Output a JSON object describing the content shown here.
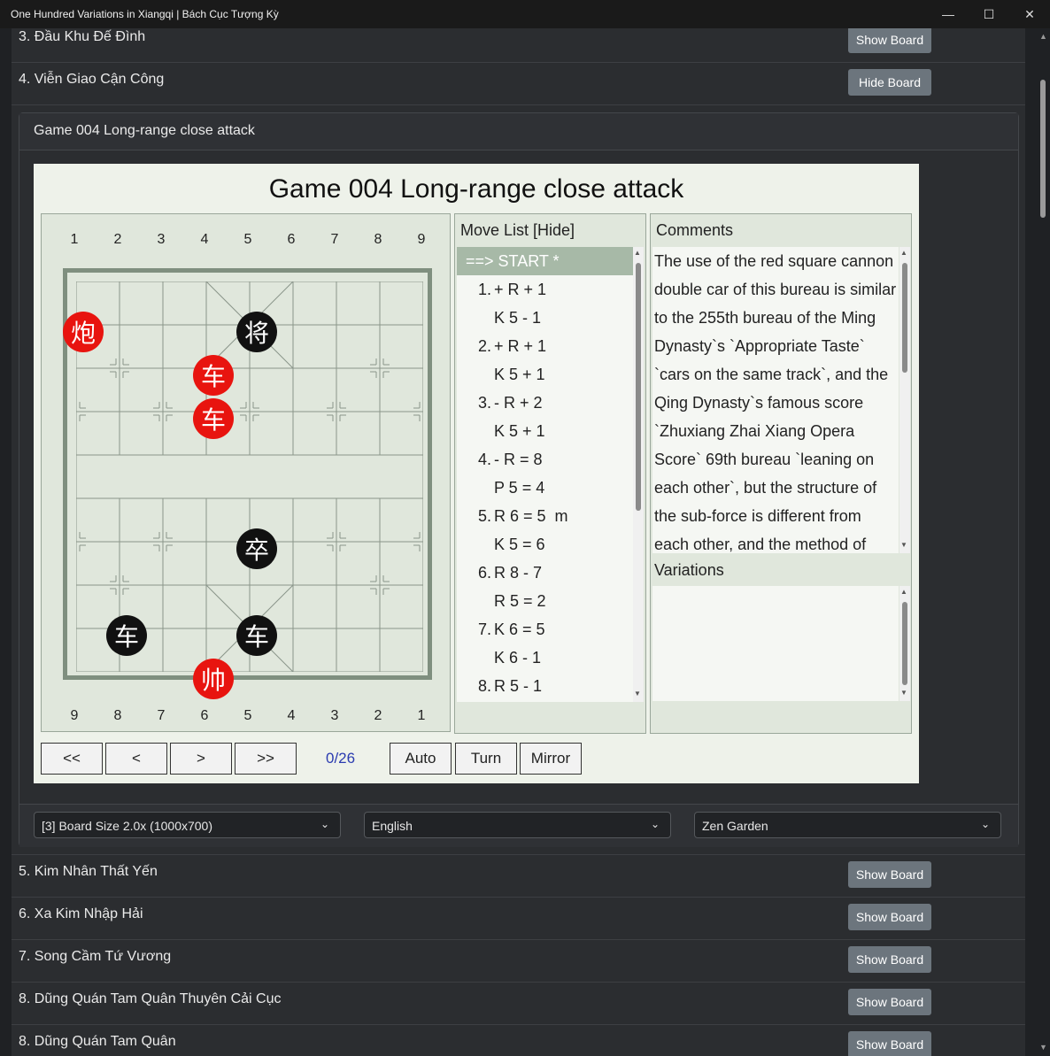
{
  "window": {
    "title": "One Hundred Variations in Xiangqi | Bách Cục Tượng Kỳ",
    "minimize_glyph": "—",
    "maximize_glyph": "☐",
    "close_glyph": "✕"
  },
  "rows_above": [
    {
      "label": "3. Đầu Khu Đế Đình",
      "button": "Show Board"
    },
    {
      "label": "4. Viễn Giao Cận Công",
      "button": "Hide Board"
    }
  ],
  "card": {
    "header": "Game 004 Long-range close attack",
    "game_title": "Game 004 Long-range close attack",
    "top_coords": [
      "1",
      "2",
      "3",
      "4",
      "5",
      "6",
      "7",
      "8",
      "9"
    ],
    "bottom_coords": [
      "9",
      "8",
      "7",
      "6",
      "5",
      "4",
      "3",
      "2",
      "1"
    ],
    "pieces": [
      {
        "char": "炮",
        "color": "red",
        "col": 0,
        "row": 1
      },
      {
        "char": "将",
        "color": "black",
        "col": 4,
        "row": 1
      },
      {
        "char": "车",
        "color": "red",
        "col": 3,
        "row": 2
      },
      {
        "char": "车",
        "color": "red",
        "col": 3,
        "row": 3
      },
      {
        "char": "卒",
        "color": "black",
        "col": 4,
        "row": 6
      },
      {
        "char": "车",
        "color": "black",
        "col": 1,
        "row": 8
      },
      {
        "char": "车",
        "color": "black",
        "col": 4,
        "row": 8
      },
      {
        "char": "帅",
        "color": "red",
        "col": 3,
        "row": 9
      }
    ],
    "move_list": {
      "header": "Move List [Hide]",
      "moves": [
        {
          "num": "",
          "text": "==> START *"
        },
        {
          "num": "1.",
          "text": "+ R + 1"
        },
        {
          "num": "",
          "text": "K 5 - 1"
        },
        {
          "num": "2.",
          "text": "+ R + 1"
        },
        {
          "num": "",
          "text": "K 5 + 1"
        },
        {
          "num": "3.",
          "text": "- R + 2"
        },
        {
          "num": "",
          "text": "K 5 + 1"
        },
        {
          "num": "4.",
          "text": "- R = 8"
        },
        {
          "num": "",
          "text": "P 5 = 4"
        },
        {
          "num": "5.",
          "text": "R 6 = 5  m"
        },
        {
          "num": "",
          "text": "K 5 = 6"
        },
        {
          "num": "6.",
          "text": "R 8 - 7"
        },
        {
          "num": "",
          "text": "R 5 = 2"
        },
        {
          "num": "7.",
          "text": "K 6 = 5"
        },
        {
          "num": "",
          "text": "K 6 - 1"
        },
        {
          "num": "8.",
          "text": "R 5 - 1"
        }
      ]
    },
    "comments": {
      "header": "Comments",
      "lines": [
        "The use of the red square cannon",
        "double car of this bureau is similar",
        "to the 255th bureau of the Ming",
        "Dynasty`s `Appropriate Taste`",
        "`cars on the same track`, and the",
        "Qing Dynasty`s famous score",
        "`Zhuxiang Zhai Xiang Opera",
        "Score` 69th bureau `leaning on",
        "each other`, but the structure of",
        "the sub-force is different from",
        "each other, and the method of"
      ],
      "variations_header": "Variations"
    },
    "controls": {
      "first": "<<",
      "prev": "<",
      "next": ">",
      "last": ">>",
      "counter": "0/26",
      "auto": "Auto",
      "turn": "Turn",
      "mirror": "Mirror"
    },
    "selects": {
      "board_size": "[3] Board Size 2.0x (1000x700)",
      "language": "English",
      "theme": "Zen Garden"
    }
  },
  "rows_below": [
    {
      "label": "5. Kim Nhân Thất Yến",
      "button": "Show Board"
    },
    {
      "label": "6. Xa Kim Nhập Hải",
      "button": "Show Board"
    },
    {
      "label": "7. Song Cầm Tứ Vương",
      "button": "Show Board"
    },
    {
      "label": "8. Dũng Quán Tam Quân Thuyên Cải Cục",
      "button": "Show Board"
    },
    {
      "label": "8. Dũng Quán Tam Quân",
      "button": "Show Board"
    }
  ]
}
